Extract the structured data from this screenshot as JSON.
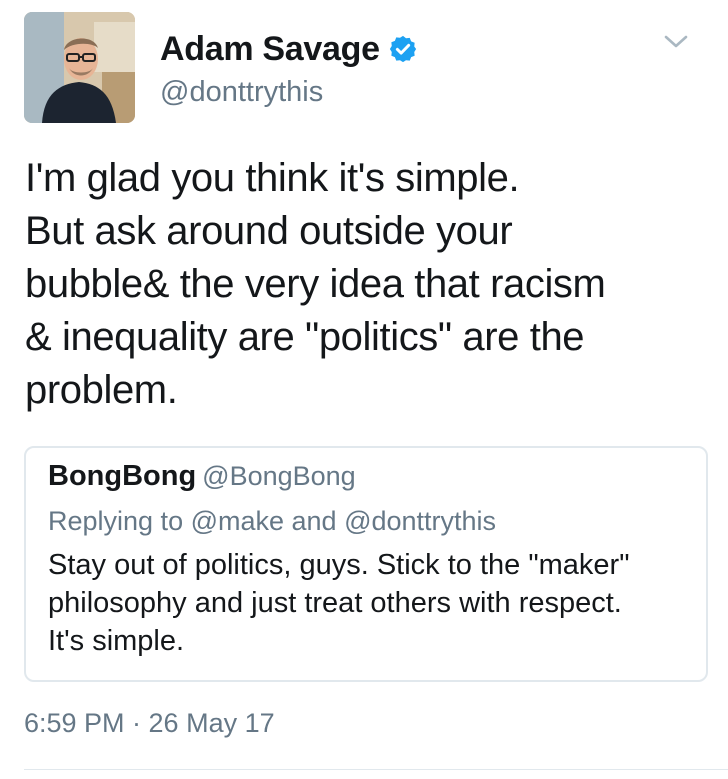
{
  "author": {
    "display_name": "Adam Savage",
    "handle": "@donttrythis",
    "verified": true,
    "avatar_icon": "user-avatar-photo"
  },
  "tweet": {
    "text": "I'm glad you think it's simple.\nBut ask around outside your\nbubble& the very idea that racism\n& inequality are \"politics\" are the\nproblem.",
    "timestamp": "6:59 PM · 26 May 17"
  },
  "quoted_tweet": {
    "display_name": "BongBong",
    "handle": "@BongBong",
    "replying_to": "Replying to @make and @donttrythis",
    "text": "Stay out of politics, guys. Stick to the \"maker\"\nphilosophy and just treat others with respect.\nIt's simple."
  },
  "colors": {
    "text_primary": "#14171a",
    "text_secondary": "#657786",
    "verified_blue": "#1da1f2",
    "border": "#e1e8ed"
  }
}
